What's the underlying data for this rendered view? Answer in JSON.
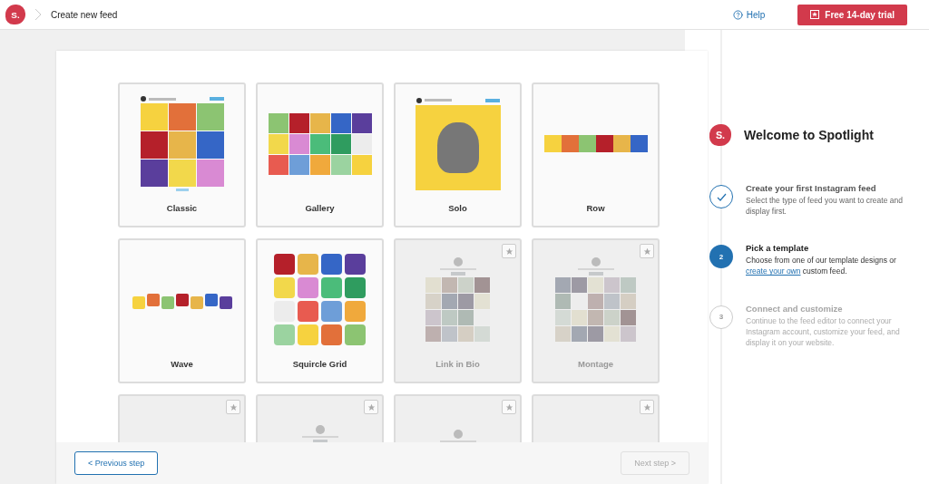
{
  "topbar": {
    "logo": "S.",
    "breadcrumb": "Create new feed",
    "help": "Help",
    "trial": "Free 14-day trial"
  },
  "templates": [
    {
      "label": "Classic",
      "kind": "classic",
      "pro": false
    },
    {
      "label": "Gallery",
      "kind": "gallery",
      "pro": false
    },
    {
      "label": "Solo",
      "kind": "solo",
      "pro": false
    },
    {
      "label": "Row",
      "kind": "row",
      "pro": false
    },
    {
      "label": "Wave",
      "kind": "wave",
      "pro": false
    },
    {
      "label": "Squircle Grid",
      "kind": "squircle",
      "pro": false
    },
    {
      "label": "Link in Bio",
      "kind": "bio",
      "pro": true
    },
    {
      "label": "Montage",
      "kind": "montage",
      "pro": true
    },
    {
      "kind": "blank",
      "pro": true
    },
    {
      "kind": "bio",
      "pro": true
    },
    {
      "kind": "feature",
      "pro": true
    },
    {
      "kind": "blank",
      "pro": true
    }
  ],
  "footer": {
    "previous": "< Previous step",
    "next": "Next step >",
    "next_disabled": true
  },
  "sidebar": {
    "logo": "S.",
    "title": "Welcome to Spotlight",
    "steps": [
      {
        "completed": true,
        "selected": false,
        "title": "Create your first Instagram feed",
        "text": "Select the type of feed you want to create and display first."
      },
      {
        "completed": false,
        "selected": true,
        "marker": "2",
        "title": "Pick a template",
        "text": "Choose from one of our template designs or",
        "link": "create your own",
        "text_after": "custom feed."
      },
      {
        "completed": false,
        "selected": false,
        "marker": "3",
        "title": "Connect and customize",
        "text": "Continue to the feed editor to connect your Instagram account, customize your feed, and display it on your website."
      }
    ]
  }
}
